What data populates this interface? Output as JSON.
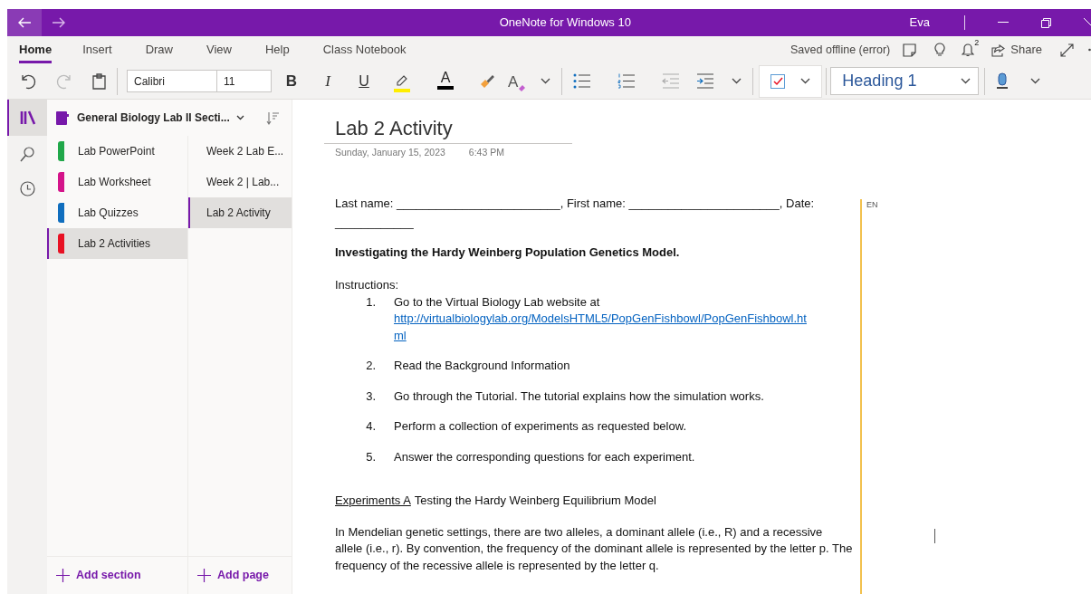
{
  "window": {
    "title": "OneNote for Windows 10",
    "user": "Eva"
  },
  "ribbon_tabs": [
    {
      "label": "Home",
      "selected": true
    },
    {
      "label": "Insert",
      "selected": false
    },
    {
      "label": "Draw",
      "selected": false
    },
    {
      "label": "View",
      "selected": false
    },
    {
      "label": "Help",
      "selected": false
    },
    {
      "label": "Class Notebook",
      "selected": false
    }
  ],
  "status": "Saved offline (error)",
  "notifications": "2",
  "share": "Share",
  "toolbar": {
    "font": "Calibri",
    "size": "11",
    "format_buttons": [
      {
        "kind": "bold",
        "label": "B"
      },
      {
        "kind": "italic",
        "label": "I"
      },
      {
        "kind": "underline",
        "label": "U"
      }
    ],
    "font_color_label": "A",
    "clear_format_label": "A",
    "style": "Heading 1"
  },
  "notebook": {
    "name": "General Biology Lab II Secti...",
    "sections": [
      {
        "label": "Lab PowerPoint",
        "color": "#21a84a",
        "selected": false
      },
      {
        "label": "Lab Worksheet",
        "color": "#d4148a",
        "selected": false
      },
      {
        "label": "Lab Quizzes",
        "color": "#106ebe",
        "selected": false
      },
      {
        "label": "Lab 2 Activities",
        "color": "#e81123",
        "selected": true
      }
    ],
    "pages": [
      {
        "label": "Week 2 Lab E...",
        "selected": false
      },
      {
        "label": "Week 2 | Lab...",
        "selected": false
      },
      {
        "label": "Lab 2 Activity",
        "selected": true
      }
    ],
    "add_section": "Add section",
    "add_page": "Add page"
  },
  "page": {
    "title": "Lab 2 Activity",
    "date": "Sunday, January 15, 2023",
    "time": "6:43 PM",
    "language": "EN",
    "name_line": "Last name: _________________________, First name: _______________________, Date: ____________",
    "heading": "Investigating the Hardy Weinberg Population Genetics Model.",
    "instructions_label": "Instructions:",
    "steps": [
      {
        "number": "1.",
        "text": "Go to the Virtual Biology Lab website at",
        "link": "http://virtualbiologylab.org/ModelsHTML5/PopGenFishbowl/PopGenFishbowl.html"
      },
      {
        "number": "2.",
        "text": "Read the Background Information"
      },
      {
        "number": "3.",
        "text": "Go through the Tutorial.  The tutorial explains how the simulation works."
      },
      {
        "number": "4.",
        "text": "Perform a collection of experiments as requested below."
      },
      {
        "number": "5.",
        "text": "Answer the corresponding questions for each experiment."
      }
    ],
    "experiments_label": "Experiments A",
    "experiments_title": "Testing the Hardy Weinberg Equilibrium Model",
    "paragraph": "In Mendelian  genetic settings, there are two alleles, a dominant allele (i.e., R) and a recessive allele (i.e., r).  By convention, the frequency of the dominant allele is represented by the letter p.  The frequency of the recessive allele is represented by the letter q."
  }
}
